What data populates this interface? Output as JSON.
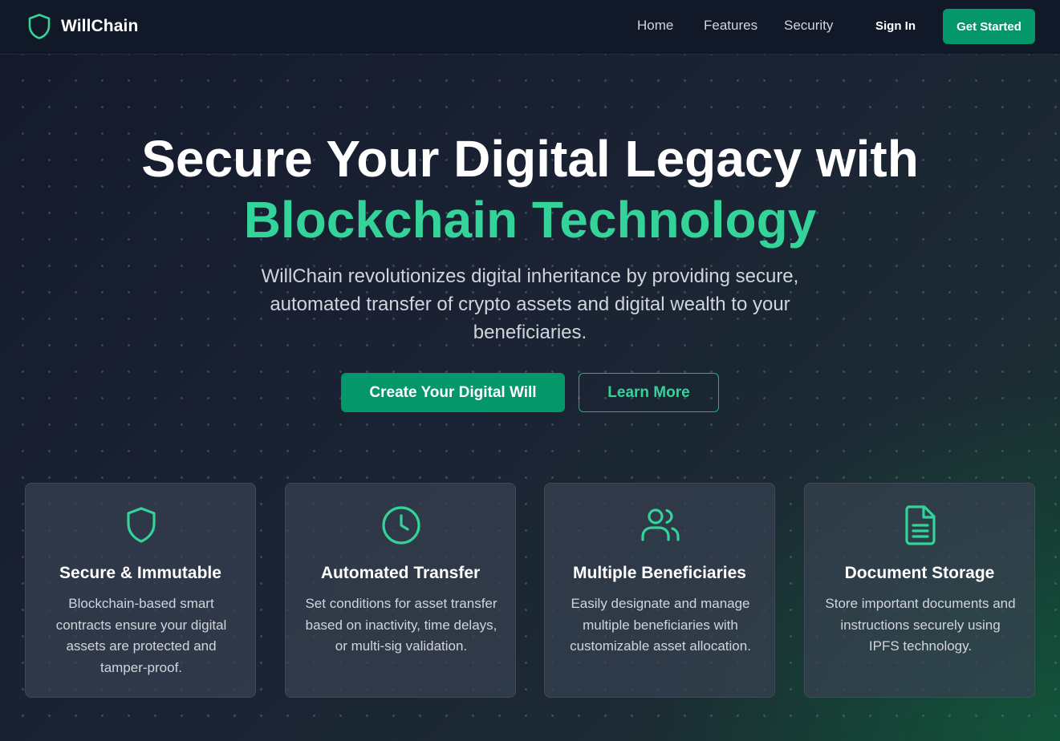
{
  "colors": {
    "accent": "#10b981",
    "accent_text": "#34d399",
    "button_green": "#059669",
    "nav_bg": "#111827",
    "card_bg": "#374151"
  },
  "nav": {
    "brand": "WillChain",
    "brand_icon": "shield-icon",
    "links": [
      "Home",
      "Features",
      "Security"
    ],
    "sign_in": "Sign In",
    "get_started": "Get Started"
  },
  "hero": {
    "title_line1": "Secure Your Digital Legacy with",
    "title_line2": "Blockchain Technology",
    "subtitle": "WillChain revolutionizes digital inheritance by providing secure, automated transfer of crypto assets and digital wealth to your beneficiaries.",
    "primary_cta": "Create Your Digital Will",
    "secondary_cta": "Learn More"
  },
  "features": [
    {
      "icon": "shield-icon",
      "title": "Secure & Immutable",
      "description": "Blockchain-based smart contracts ensure your digital assets are protected and tamper-proof."
    },
    {
      "icon": "clock-icon",
      "title": "Automated Transfer",
      "description": "Set conditions for asset transfer based on inactivity, time delays, or multi-sig validation."
    },
    {
      "icon": "users-icon",
      "title": "Multiple Beneficiaries",
      "description": "Easily designate and manage multiple beneficiaries with customizable asset allocation."
    },
    {
      "icon": "document-icon",
      "title": "Document Storage",
      "description": "Store important documents and instructions securely using IPFS technology."
    }
  ]
}
